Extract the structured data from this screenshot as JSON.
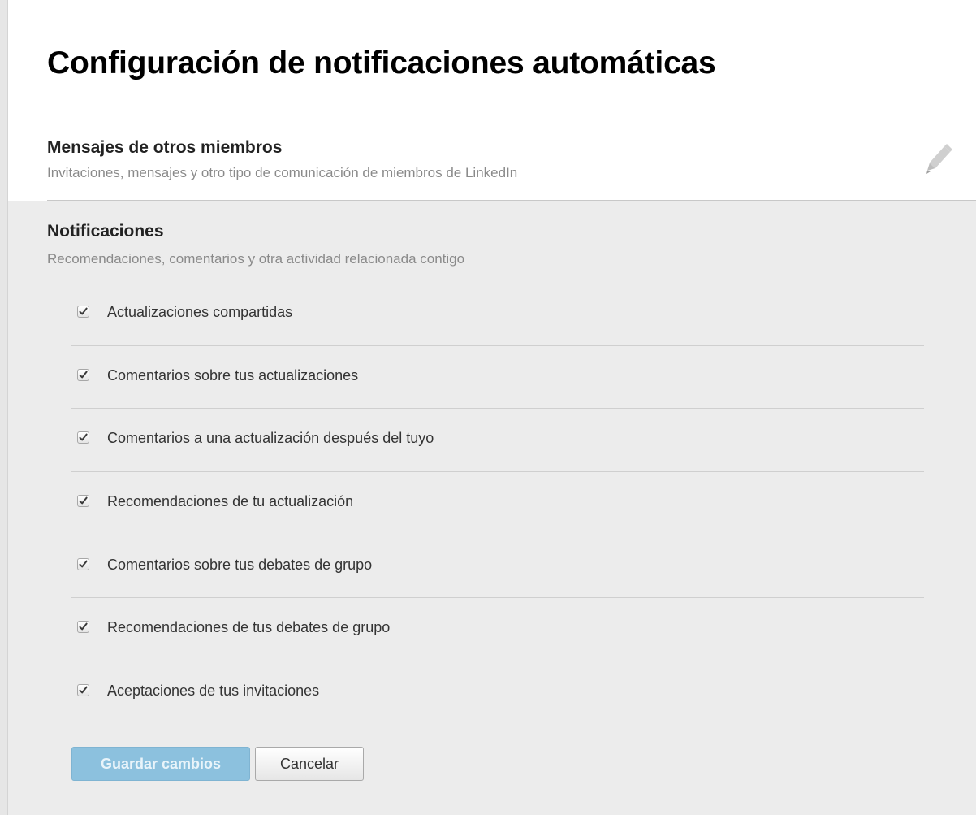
{
  "page": {
    "title": "Configuración de notificaciones automáticas"
  },
  "messages_section": {
    "title": "Mensajes de otros miembros",
    "description": "Invitaciones, mensajes y otro tipo de comunicación de miembros de LinkedIn",
    "edit_icon": "pencil-icon"
  },
  "notifications_section": {
    "title": "Notificaciones",
    "description": "Recomendaciones, comentarios y otra actividad relacionada contigo",
    "options": [
      {
        "label": "Actualizaciones compartidas",
        "checked": true
      },
      {
        "label": "Comentarios sobre tus actualizaciones",
        "checked": true
      },
      {
        "label": "Comentarios a una actualización después del tuyo",
        "checked": true
      },
      {
        "label": "Recomendaciones de tu actualización",
        "checked": true
      },
      {
        "label": "Comentarios sobre tus debates de grupo",
        "checked": true
      },
      {
        "label": "Recomendaciones de tus debates de grupo",
        "checked": true
      },
      {
        "label": "Aceptaciones de tus invitaciones",
        "checked": true
      }
    ]
  },
  "actions": {
    "save_label": "Guardar cambios",
    "cancel_label": "Cancelar"
  },
  "colors": {
    "panel_background": "#ececec",
    "save_button": "#8cc1de",
    "description_text": "#8a8a8a"
  }
}
